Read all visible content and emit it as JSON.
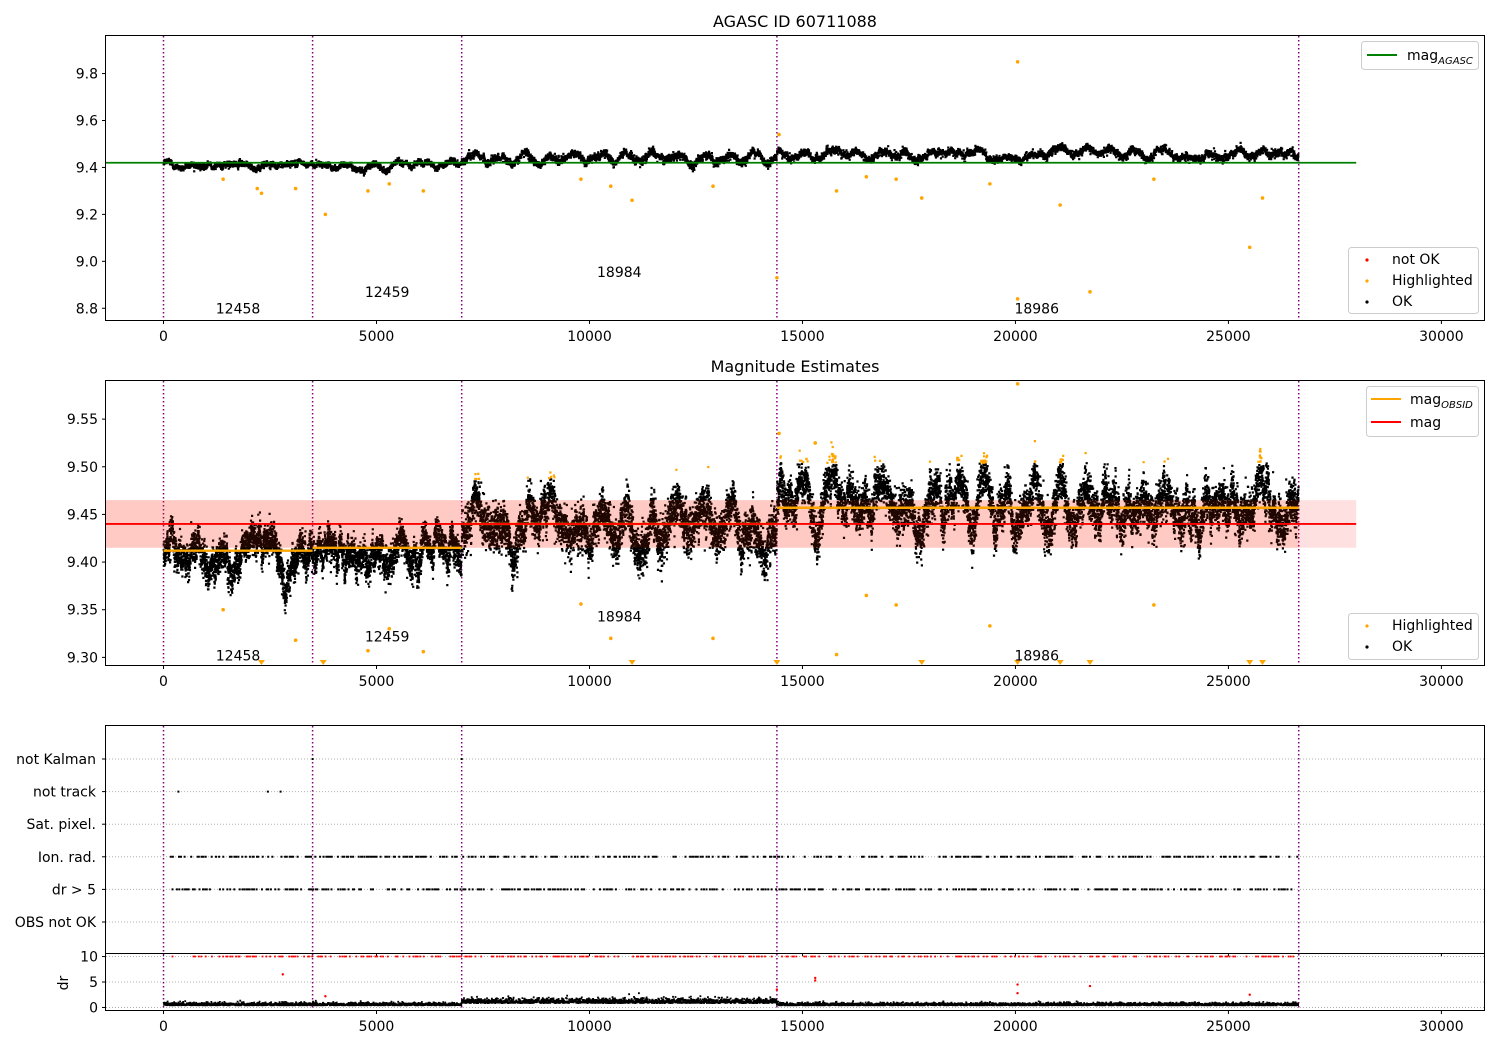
{
  "figure": {
    "obsid_label_ticks": [
      12458,
      12459,
      18984,
      18986
    ],
    "obsid_boundaries": [
      0,
      3500,
      7000,
      14400,
      26650
    ],
    "x_ticks": [
      0,
      5000,
      10000,
      15000,
      20000,
      25000,
      30000
    ],
    "xlim": [
      -1350,
      31000
    ]
  },
  "chart_data": [
    {
      "type": "scatter",
      "title": "AGASC ID 60711088",
      "xlabel": "",
      "ylabel": "",
      "ylim": [
        8.75,
        9.96
      ],
      "y_ticks": [
        8.8,
        9.0,
        9.2,
        9.4,
        9.6,
        9.8
      ],
      "y_tick_labels": [
        "8.8",
        "9.0",
        "9.2",
        "9.4",
        "9.6",
        "9.8"
      ],
      "grid": false,
      "legend_top": {
        "placement": "top-right",
        "entries": [
          {
            "label": "mag",
            "sub": "AGASC",
            "color": "#008000"
          }
        ]
      },
      "legend_bottom": {
        "placement": "bottom-right",
        "entries": [
          {
            "label": "not OK",
            "color": "#ff0000"
          },
          {
            "label": "Highlighted",
            "color": "#ffa500"
          },
          {
            "label": "OK",
            "color": "#000000"
          }
        ]
      },
      "obsids": [
        {
          "label": "12458",
          "x": 1750,
          "y": 8.8,
          "x_range": [
            0,
            3500
          ],
          "mean": 9.412
        },
        {
          "label": "12459",
          "x": 5250,
          "y": 8.87,
          "x_range": [
            3500,
            7000
          ],
          "mean": 9.415
        },
        {
          "label": "18984",
          "x": 10700,
          "y": 8.955,
          "x_range": [
            7000,
            14400
          ],
          "mean": 9.44
        },
        {
          "label": "18986",
          "x": 20500,
          "y": 8.8,
          "x_range": [
            14400,
            26650
          ],
          "mean": 9.457
        }
      ],
      "mag_agasc": {
        "value": 9.42,
        "x_range": [
          -1350,
          28000
        ]
      },
      "outliers": [
        [
          1400,
          9.35
        ],
        [
          2200,
          9.31
        ],
        [
          2300,
          9.29
        ],
        [
          3100,
          9.31
        ],
        [
          3800,
          9.2
        ],
        [
          4800,
          9.3
        ],
        [
          5300,
          9.33
        ],
        [
          6100,
          9.3
        ],
        [
          9800,
          9.35
        ],
        [
          10500,
          9.32
        ],
        [
          11000,
          9.26
        ],
        [
          12900,
          9.32
        ],
        [
          14400,
          8.93
        ],
        [
          15800,
          9.3
        ],
        [
          16500,
          9.36
        ],
        [
          17200,
          9.35
        ],
        [
          17800,
          9.27
        ],
        [
          19400,
          9.33
        ],
        [
          20050,
          8.84
        ],
        [
          20050,
          9.85
        ],
        [
          21050,
          9.24
        ],
        [
          21750,
          8.87
        ],
        [
          23250,
          9.35
        ],
        [
          25500,
          9.06
        ],
        [
          25800,
          9.27
        ],
        [
          14450,
          9.54
        ]
      ]
    },
    {
      "type": "scatter",
      "title": "Magnitude Estimates",
      "xlabel": "",
      "ylabel": "",
      "ylim": [
        9.292,
        9.59
      ],
      "y_ticks": [
        9.3,
        9.35,
        9.4,
        9.45,
        9.5,
        9.55
      ],
      "y_tick_labels": [
        "9.30",
        "9.35",
        "9.40",
        "9.45",
        "9.50",
        "9.55"
      ],
      "grid": false,
      "legend_top": {
        "placement": "top-right",
        "entries": [
          {
            "label": "mag",
            "sub": "OBSID",
            "color": "#ffa500"
          },
          {
            "label": "mag",
            "color": "#ff0000"
          }
        ]
      },
      "legend_bottom": {
        "placement": "bottom-right",
        "entries": [
          {
            "label": "Highlighted",
            "color": "#ffa500"
          },
          {
            "label": "OK",
            "color": "#000000"
          }
        ]
      },
      "obsids": [
        {
          "label": "12458",
          "x": 1750,
          "y": 9.302,
          "x_range": [
            0,
            3500
          ],
          "mean": 9.412
        },
        {
          "label": "12459",
          "x": 5250,
          "y": 9.322,
          "x_range": [
            3500,
            7000
          ],
          "mean": 9.415
        },
        {
          "label": "18984",
          "x": 10700,
          "y": 9.343,
          "x_range": [
            7000,
            14400
          ],
          "mean": 9.44
        },
        {
          "label": "18986",
          "x": 20500,
          "y": 9.302,
          "x_range": [
            14400,
            26650
          ],
          "mean": 9.457
        }
      ],
      "mag": {
        "value": 9.44,
        "band": [
          9.415,
          9.465
        ],
        "x_range": [
          -1350,
          28000
        ]
      },
      "outliers": [
        [
          1400,
          9.35
        ],
        [
          3100,
          9.318
        ],
        [
          4800,
          9.307
        ],
        [
          5300,
          9.33
        ],
        [
          6100,
          9.306
        ],
        [
          9800,
          9.356
        ],
        [
          10500,
          9.32
        ],
        [
          12900,
          9.32
        ],
        [
          15800,
          9.303
        ],
        [
          16500,
          9.365
        ],
        [
          17200,
          9.355
        ],
        [
          19400,
          9.333
        ],
        [
          23250,
          9.355
        ],
        [
          20050,
          9.587
        ],
        [
          14450,
          9.535
        ],
        [
          15300,
          9.525
        ]
      ],
      "below_markers": [
        2300,
        3750,
        11000,
        14400,
        17800,
        20050,
        21050,
        21750,
        25500,
        25800
      ]
    },
    {
      "type": "scatter",
      "title": "",
      "flags": [
        "not Kalman",
        "not track",
        "Sat. pixel.",
        "Ion. rad.",
        "dr > 5",
        "OBS not OK"
      ],
      "flag_hits": {
        "not Kalman": [
          3500,
          7000
        ],
        "not track": [
          350,
          2450,
          2750
        ],
        "Sat. pixel.": [],
        "Ion. rad.": "dense",
        "dr > 5": "dense",
        "OBS not OK": []
      }
    },
    {
      "type": "scatter",
      "title": "",
      "xlabel": "",
      "ylabel": "dr",
      "ylim": [
        -0.5,
        10.5
      ],
      "y_ticks": [
        0,
        5,
        10
      ],
      "y_tick_labels": [
        "0",
        "5",
        "10"
      ],
      "grid": true,
      "dr_typical": 0.4,
      "dr_clipped": 10,
      "dr_outliers": [
        [
          2800,
          6.5
        ],
        [
          15300,
          5.8
        ],
        [
          15300,
          5.3
        ],
        [
          20050,
          4.5
        ],
        [
          20050,
          2.8
        ],
        [
          21750,
          4.2
        ],
        [
          3800,
          2.2
        ],
        [
          14400,
          3.5
        ],
        [
          25500,
          2.5
        ]
      ]
    }
  ]
}
